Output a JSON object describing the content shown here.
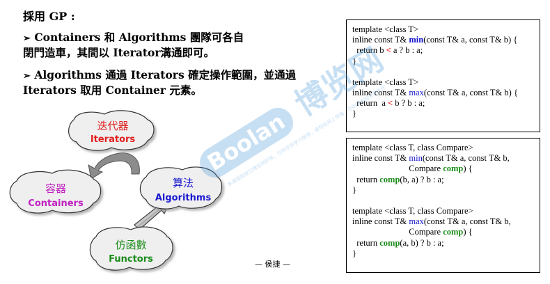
{
  "heading": "採用 GP :",
  "bullets": [
    {
      "marker": "➢",
      "line1": "Containers 和 Algorithms 團隊可各自",
      "line2": "閉門造車，其間以 Iterator溝通即可。"
    },
    {
      "marker": "➢",
      "line1": "Algorithms 通過 Iterators 確定操作範圍，並通過",
      "line2": "Iterators 取用 Container 元素。"
    }
  ],
  "diagram": {
    "iterators": {
      "zh": "迭代器",
      "en": "Iterators"
    },
    "containers": {
      "zh": "容器",
      "en": "Containers"
    },
    "algorithms": {
      "zh": "算法",
      "en": "Algorithms"
    },
    "functors": {
      "zh": "仿函數",
      "en": "Functors"
    }
  },
  "code1": {
    "min_t1": "template <class T>",
    "min_sig_pre": "inline const T& ",
    "min_name": "min",
    "min_sig_post": "(const T& a, const T& b) {",
    "min_ret_pre": "  return b ",
    "min_op": "<",
    "min_ret_post": " a ? b : a;",
    "min_close": "}",
    "max_t1": "template <class T>",
    "max_sig_pre": "inline const T& ",
    "max_name": "max",
    "max_sig_post": "(const T& a, const T& b) {",
    "max_ret_pre": "  return  a ",
    "max_op": "<",
    "max_ret_post": " b ? b : a;",
    "max_close": "}"
  },
  "code2": {
    "min_t1": "template <class T, class Compare>",
    "min_sig_pre": "inline const T& ",
    "min_name": "min",
    "min_sig_post": "(const T& a, const T& b,",
    "min_sig2_pre": "                          Compare ",
    "min_comp_param": "comp",
    "min_sig2_post": ") {",
    "min_ret_pre": "  return ",
    "min_comp_call": "comp",
    "min_ret_post": "(b, a) ? b : a;",
    "min_close": "}",
    "max_t1": "template <class T, class Compare>",
    "max_sig_pre": "inline const T& ",
    "max_name": "max",
    "max_sig_post": "(const T& a, const T& b,",
    "max_sig2_pre": "                          Compare ",
    "max_comp_param": "comp",
    "max_sig2_post": ") {",
    "max_ret_pre": "  return ",
    "max_comp_call": "comp",
    "max_ret_post": "(a, b) ? b : a;",
    "max_close": "}"
  },
  "author": "— 侯捷 —",
  "watermark": {
    "logo": "Boolan",
    "brand": "博览网",
    "notice": "本课程版权归博览网所有，仅供学员学习使用，请勿在网上传播，否则将追究法律责任"
  },
  "colors": {
    "iterators": "#e02020",
    "containers": "#c020c0",
    "algorithms": "#1a1ad0",
    "functors": "#1a8c1a",
    "accent_blue": "#1515cc",
    "compare_green": "#1a8c1a",
    "less_red": "#e00000"
  }
}
